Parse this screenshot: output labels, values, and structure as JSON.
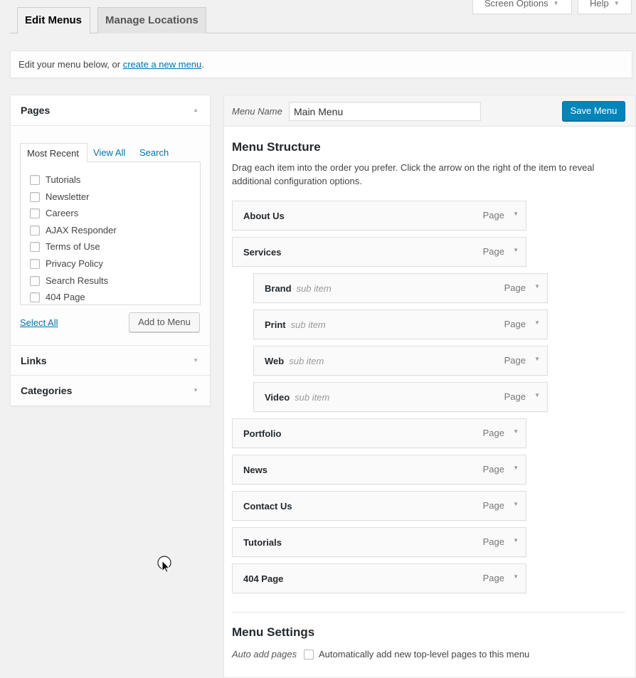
{
  "screen_meta": {
    "screen_options": "Screen Options",
    "help": "Help"
  },
  "nav_tabs": {
    "edit_menus": "Edit Menus",
    "manage_locations": "Manage Locations"
  },
  "notice": {
    "text": "Edit your menu below, or ",
    "link": "create a new menu",
    "suffix": "."
  },
  "accordion": {
    "pages": {
      "title": "Pages",
      "tabs": [
        "Most Recent",
        "View All",
        "Search"
      ],
      "items": [
        "Tutorials",
        "Newsletter",
        "Careers",
        "AJAX Responder",
        "Terms of Use",
        "Privacy Policy",
        "Search Results",
        "404 Page"
      ],
      "select_all": "Select All",
      "add_to_menu": "Add to Menu"
    },
    "links": {
      "title": "Links"
    },
    "categories": {
      "title": "Categories"
    }
  },
  "menu": {
    "name_label": "Menu Name",
    "name_value": "Main Menu",
    "save_label": "Save Menu",
    "structure_title": "Menu Structure",
    "instructions": "Drag each item into the order you prefer. Click the arrow on the right of the item to reveal additional configuration options.",
    "items": [
      {
        "title": "About Us",
        "sub": "",
        "type": "Page",
        "depth": 0
      },
      {
        "title": "Services",
        "sub": "",
        "type": "Page",
        "depth": 0
      },
      {
        "title": "Brand",
        "sub": "sub item",
        "type": "Page",
        "depth": 1
      },
      {
        "title": "Print",
        "sub": "sub item",
        "type": "Page",
        "depth": 1
      },
      {
        "title": "Web",
        "sub": "sub item",
        "type": "Page",
        "depth": 1
      },
      {
        "title": "Video",
        "sub": "sub item",
        "type": "Page",
        "depth": 1
      },
      {
        "title": "Portfolio",
        "sub": "",
        "type": "Page",
        "depth": 0
      },
      {
        "title": "News",
        "sub": "",
        "type": "Page",
        "depth": 0
      },
      {
        "title": "Contact Us",
        "sub": "",
        "type": "Page",
        "depth": 0
      },
      {
        "title": "Tutorials",
        "sub": "",
        "type": "Page",
        "depth": 0
      },
      {
        "title": "404 Page",
        "sub": "",
        "type": "Page",
        "depth": 0
      }
    ],
    "settings_title": "Menu Settings",
    "auto_add_label": "Auto add pages",
    "auto_add_text": "Automatically add new top-level pages to this menu"
  },
  "colors": {
    "primary": "#0085ba",
    "link": "#0073aa",
    "background": "#f1f1f1"
  }
}
